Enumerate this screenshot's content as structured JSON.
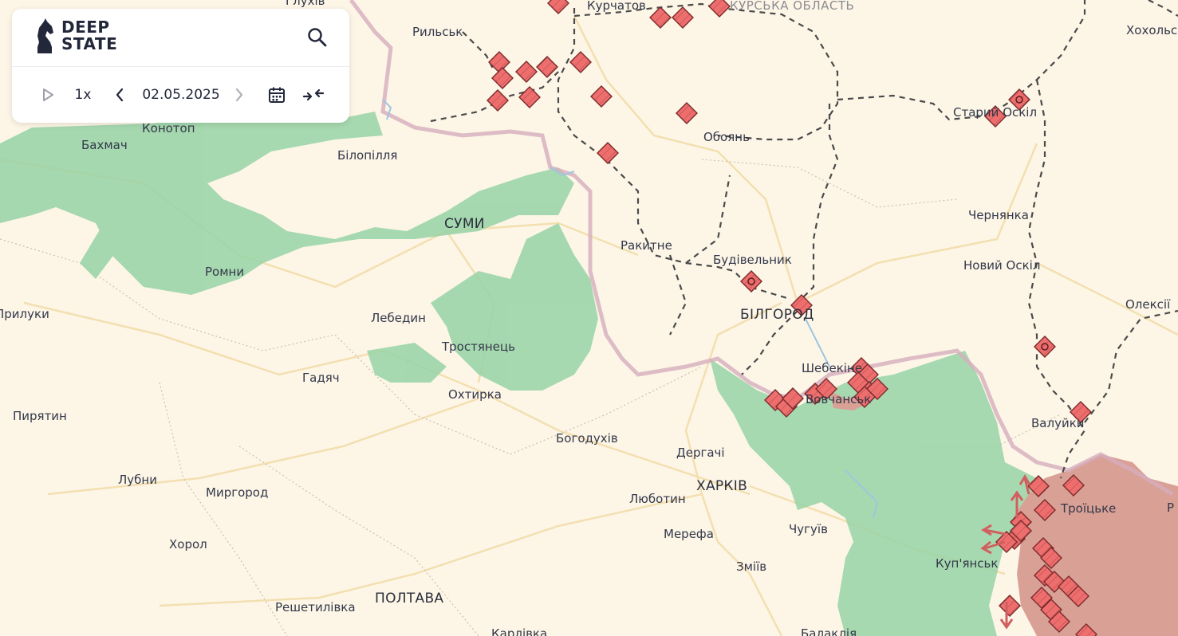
{
  "logo": {
    "line1": "DEEP",
    "line2": "STATE"
  },
  "toolbar": {
    "speed": "1x",
    "date": "02.05.2025"
  },
  "icons": {
    "logo": "knight-chess-icon",
    "search": "search-icon",
    "play": "play-icon",
    "prev": "chevron-left-icon",
    "next": "chevron-right-icon",
    "calendar": "calendar-icon",
    "compare": "compress-arrows-icon"
  },
  "colors": {
    "background": "#fdf6e7",
    "liberated": "#8fcf9f",
    "occupied": "#d99f94",
    "border": "#d6aebe",
    "marker": "#ee6d6d",
    "road": "#f2dcaa"
  },
  "places": {
    "glukhiv": "Глухів",
    "kurchatov": "Курчатов",
    "kursk_oblast": "КУРСЬКА ОБЛАСТЬ",
    "khokholsky": "Хохольсь",
    "rylsk": "Рильськ",
    "konotop": "Конотоп",
    "bakhmach": "Бахмач",
    "bilopillia": "Білопілля",
    "oboian": "Обоянь",
    "stary_oskil": "Старий Оскіл",
    "sumy": "СУМИ",
    "chernianka": "Чернянка",
    "romny": "Ромни",
    "rokytne": "Ракитне",
    "budivelnyk": "Будівельник",
    "novyi_oskil": "Новий Оскіл",
    "pryluky": "Прилуки",
    "lebedyn": "Лебедин",
    "bilhorod": "БІЛГОРОД",
    "oleksiivka": "Олексії",
    "trostianets": "Тростянець",
    "hadiach": "Гадяч",
    "shebekyne": "Шебекіне",
    "okhtyrka": "Охтирка",
    "vovchansk": "Вовчанськ",
    "pyriatyn": "Пирятин",
    "valuiky": "Валуйки",
    "bohodukhiv": "Богодухів",
    "derhachi": "Дергачі",
    "lubny": "Лубни",
    "myrhorod": "Миргород",
    "kharkiv": "ХАРКІВ",
    "troitske": "Троїцьке",
    "r_edge": "Р",
    "lyubotyn": "Люботин",
    "chuhuiv": "Чугуїв",
    "khorol": "Хорол",
    "merefa": "Мерефа",
    "kupiansk": "Куп'янськ",
    "zmiiv": "Зміїв",
    "poltava": "ПОЛТАВА",
    "reshetylivka": "Решетилівка",
    "karlivka": "Карлівка",
    "balakliia": "Балаклія"
  }
}
